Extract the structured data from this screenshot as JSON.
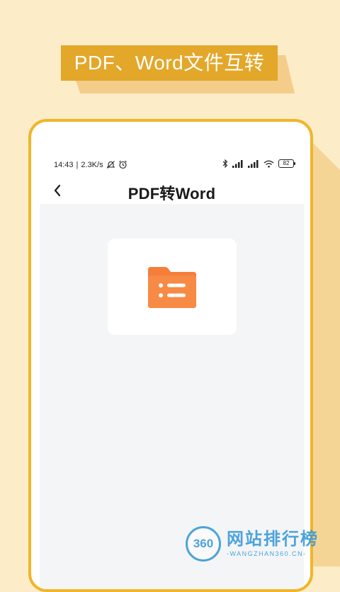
{
  "promo": {
    "headline": "PDF、Word文件互转"
  },
  "status_bar": {
    "time": "14:43",
    "network_speed": "2.3K/s",
    "separator": "|",
    "battery_level": "82"
  },
  "nav": {
    "title": "PDF转Word",
    "back_icon": "chevron-left-icon"
  },
  "content": {
    "file_picker_icon": "folder-list-icon"
  },
  "watermark": {
    "logo_text": "360",
    "name": "网站排行榜",
    "domain": "-WANGZHAN360.CN-"
  },
  "colors": {
    "background": "#fdecc8",
    "banner": "#e3a72a",
    "phone_border": "#f1b52a",
    "folder": "#f57e3b",
    "content_bg": "#f4f5f7",
    "watermark": "#3a9bd8"
  }
}
